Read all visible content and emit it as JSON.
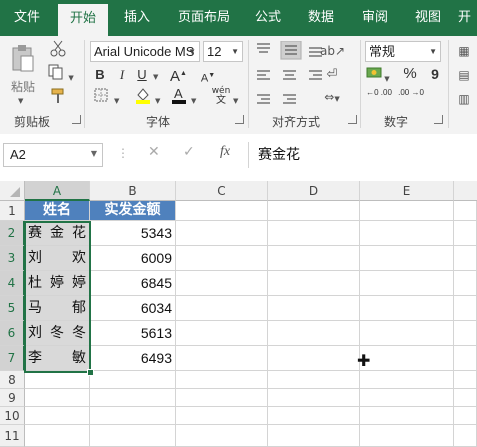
{
  "tabs": [
    "文件",
    "开始",
    "插入",
    "页面布局",
    "公式",
    "数据",
    "审阅",
    "视图",
    "开"
  ],
  "ribbon": {
    "clipboard_group": "剪贴板",
    "paste_label": "粘贴",
    "font_group": "字体",
    "font_name": "Arial Unicode MS",
    "font_size": "12",
    "bold": "B",
    "italic": "I",
    "underline": "U",
    "font_grow": "A",
    "font_shrink": "A",
    "align_group": "对齐方式",
    "number_group": "数字",
    "number_format": "常规",
    "percent": "%",
    "comma": "9",
    "increase_decimal": "←0 .00",
    "decrease_decimal": ".00 →0",
    "phonetic": "wén"
  },
  "formula_bar": {
    "name_box": "A2",
    "fx_label": "fx",
    "content": "赛金花"
  },
  "columns": [
    "A",
    "B",
    "C",
    "D",
    "E"
  ],
  "rows": [
    "1",
    "2",
    "3",
    "4",
    "5",
    "6",
    "7",
    "8",
    "9",
    "10",
    "11"
  ],
  "table": {
    "header_name": "姓名",
    "header_amount": "实发金额",
    "rows": [
      {
        "name": [
          "赛",
          "金",
          "花"
        ],
        "amount": "5343"
      },
      {
        "name": [
          "刘",
          "欢"
        ],
        "amount": "6009"
      },
      {
        "name": [
          "杜",
          "婷",
          "婷"
        ],
        "amount": "6845"
      },
      {
        "name": [
          "马",
          "郁"
        ],
        "amount": "6034"
      },
      {
        "name": [
          "刘",
          "冬",
          "冬"
        ],
        "amount": "5613"
      },
      {
        "name": [
          "李",
          "敏"
        ],
        "amount": "6493"
      }
    ]
  },
  "colors": {
    "excel_green": "#217346",
    "header_fill": "#4f81bd",
    "selection_fill": "#d9d9d9"
  }
}
